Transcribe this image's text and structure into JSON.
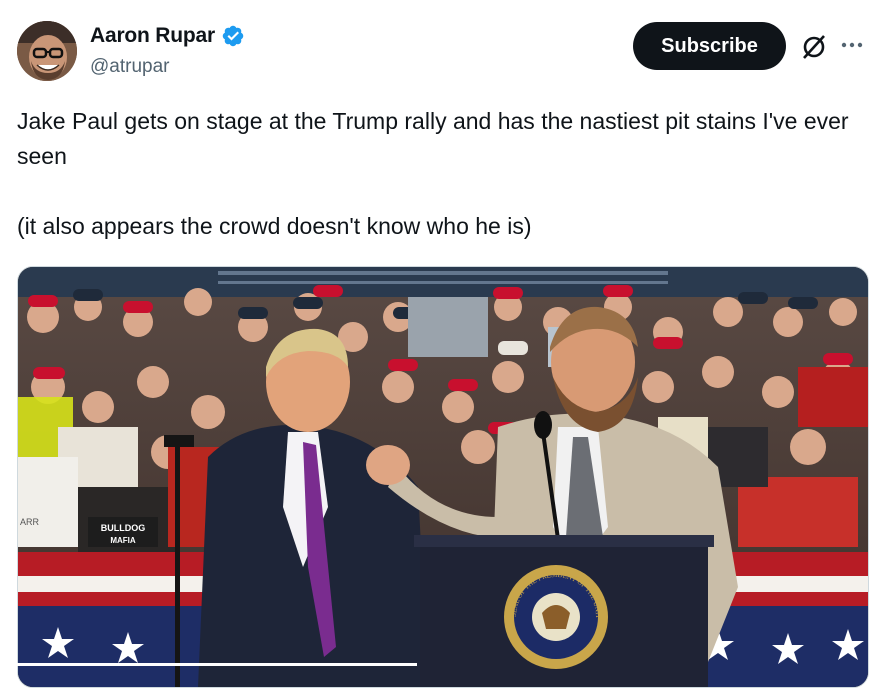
{
  "author": {
    "display_name": "Aaron Rupar",
    "handle": "@atrupar",
    "verified": true,
    "verified_color": "#1d9bf0"
  },
  "actions": {
    "subscribe_label": "Subscribe",
    "grok_icon": "grok-icon",
    "more_icon": "more-icon"
  },
  "tweet": {
    "text_line1": "Jake Paul gets on stage at the Trump rally and has the nastiest pit stains I've ever seen",
    "text_line2": "(it also appears the crowd doesn't know who he is)"
  },
  "media": {
    "type": "video",
    "seal_text": "SEAL OF THE PRESIDENT OF THE UNITED STATES",
    "sign_text_1": "BULLDOG",
    "sign_text_2": "MAFIA",
    "sign_text_3": "ARR",
    "progress_fraction": 0.47
  }
}
